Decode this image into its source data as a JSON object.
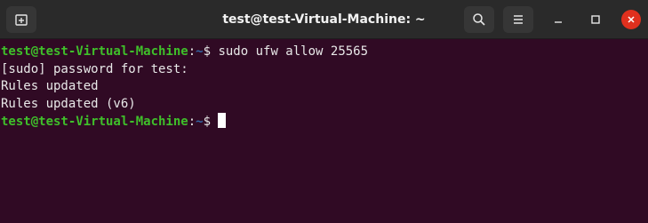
{
  "window": {
    "title": "test@test-Virtual-Machine: ~"
  },
  "titlebar": {
    "new_tab_icon": "new-tab-icon",
    "search_icon": "search-icon",
    "menu_icon": "hamburger-menu-icon",
    "minimize_icon": "minimize-icon",
    "maximize_icon": "maximize-icon",
    "close_icon": "close-icon",
    "close_color": "#e0301e"
  },
  "terminal": {
    "background": "#300a24",
    "prompt_user_color": "#3fbf2a",
    "lines": [
      {
        "type": "prompt",
        "user": "test@test-Virtual-Machine",
        "sep": ":",
        "path": "~",
        "symbol": "$ ",
        "command": "sudo ufw allow 25565"
      },
      {
        "type": "output",
        "text": "[sudo] password for test:"
      },
      {
        "type": "output",
        "text": "Rules updated"
      },
      {
        "type": "output",
        "text": "Rules updated (v6)"
      },
      {
        "type": "prompt",
        "user": "test@test-Virtual-Machine",
        "sep": ":",
        "path": "~",
        "symbol": "$ ",
        "command": ""
      }
    ]
  }
}
